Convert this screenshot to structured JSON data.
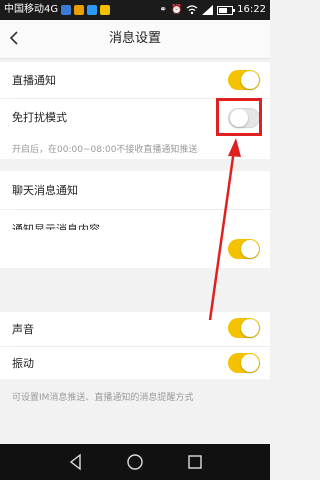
{
  "status_bar": {
    "carrier": "中国移动4G",
    "time": "16:22"
  },
  "header": {
    "title": "消息设置"
  },
  "settings": {
    "live_notification": {
      "label": "直播通知",
      "enabled": true
    },
    "do_not_disturb": {
      "label": "免打扰模式",
      "enabled": false,
      "note": "开启后，在00:00~08:00不接收直播通知推送"
    },
    "chat_notification": {
      "label": "聊天消息通知"
    },
    "show_message_content": {
      "label": "通知显示消息内容"
    },
    "unlabeled_toggle": {
      "enabled": true
    },
    "sound": {
      "label": "声音",
      "enabled": true
    },
    "vibration": {
      "label": "振动",
      "enabled": true
    },
    "footer_note": "可设置IM消息推送、直播通知的消息提醒方式"
  },
  "colors": {
    "toggle_on": "#f5c200",
    "highlight": "#e02020"
  }
}
